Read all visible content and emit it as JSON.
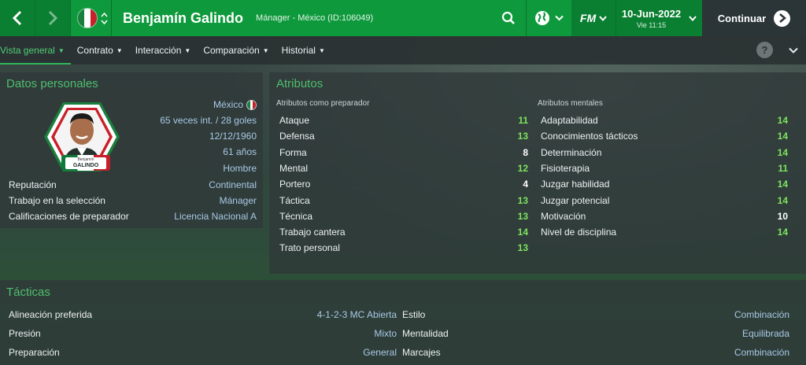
{
  "header": {
    "name": "Benjamín Galindo",
    "subtitle": "Mánager - México (ID:106049)",
    "fm_logo": "FM",
    "date": "10-Jun-2022",
    "day_time": "Vie 11:15",
    "continue_label": "Continuar",
    "flag_colors": [
      "#1a7f3c",
      "#ffffff",
      "#c8202b"
    ]
  },
  "subnav": {
    "tabs": [
      {
        "label": "Vista general",
        "active": true
      },
      {
        "label": "Contrato",
        "active": false
      },
      {
        "label": "Interacción",
        "active": false
      },
      {
        "label": "Comparación",
        "active": false
      },
      {
        "label": "Historial",
        "active": false
      }
    ],
    "help_label": "?"
  },
  "personal": {
    "title": "Datos personales",
    "nationality": "México",
    "caps": "65 veces int. / 28 goles",
    "birthdate": "12/12/1960",
    "age": "61 años",
    "gender": "Hombre",
    "badge_first": "Benjamín",
    "badge_last": "GALINDO",
    "rows": [
      {
        "label": "Reputación",
        "value": "Continental"
      },
      {
        "label": "Trabajo en la selección",
        "value": "Mánager"
      },
      {
        "label": "Calificaciones de preparador",
        "value": "Licencia Nacional A"
      }
    ]
  },
  "attributes": {
    "title": "Atributos",
    "coach_head": "Atributos como preparador",
    "mental_head": "Atributos mentales",
    "coach": [
      {
        "label": "Ataque",
        "value": "11",
        "color": "green"
      },
      {
        "label": "Defensa",
        "value": "13",
        "color": "green"
      },
      {
        "label": "Forma",
        "value": "8",
        "color": "white"
      },
      {
        "label": "Mental",
        "value": "12",
        "color": "green"
      },
      {
        "label": "Portero",
        "value": "4",
        "color": "white"
      },
      {
        "label": "Táctica",
        "value": "13",
        "color": "green"
      },
      {
        "label": "Técnica",
        "value": "13",
        "color": "green"
      },
      {
        "label": "Trabajo cantera",
        "value": "14",
        "color": "green"
      },
      {
        "label": "Trato personal",
        "value": "13",
        "color": "green"
      }
    ],
    "mental": [
      {
        "label": "Adaptabilidad",
        "value": "14",
        "color": "green"
      },
      {
        "label": "Conocimientos tácticos",
        "value": "14",
        "color": "green"
      },
      {
        "label": "Determinación",
        "value": "14",
        "color": "green"
      },
      {
        "label": "Fisioterapia",
        "value": "11",
        "color": "green"
      },
      {
        "label": "Juzgar habilidad",
        "value": "14",
        "color": "green"
      },
      {
        "label": "Juzgar potencial",
        "value": "14",
        "color": "green"
      },
      {
        "label": "Motivación",
        "value": "10",
        "color": "white"
      },
      {
        "label": "Nivel de disciplina",
        "value": "14",
        "color": "green"
      }
    ]
  },
  "tactics": {
    "title": "Tácticas",
    "left": [
      {
        "label": "Alineación preferida",
        "value": "4-1-2-3 MC Abierta"
      },
      {
        "label": "Presión",
        "value": "Mixto"
      },
      {
        "label": "Preparación",
        "value": "General"
      }
    ],
    "right": [
      {
        "label": "Estilo",
        "value": "Combinación"
      },
      {
        "label": "Mentalidad",
        "value": "Equilibrada"
      },
      {
        "label": "Marcajes",
        "value": "Combinación"
      }
    ]
  }
}
